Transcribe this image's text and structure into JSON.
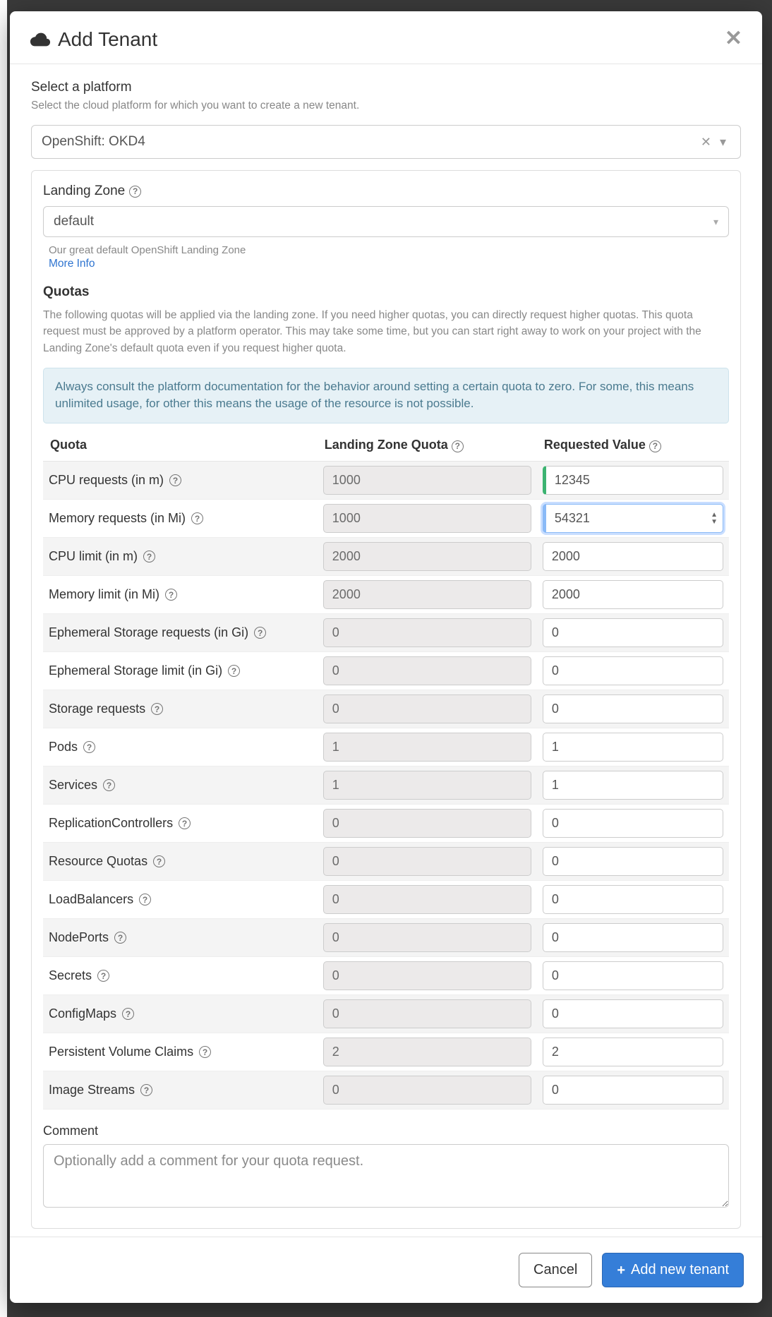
{
  "modal": {
    "title": "Add Tenant",
    "platform_section_label": "Select a platform",
    "platform_section_help": "Select the cloud platform for which you want to create a new tenant.",
    "platform_value": "OpenShift: OKD4",
    "landing_zone_label": "Landing Zone",
    "landing_zone_value": "default",
    "landing_zone_desc": "Our great default OpenShift Landing Zone",
    "landing_zone_more": "More Info",
    "quotas_title": "Quotas",
    "quotas_desc": "The following quotas will be applied via the landing zone. If you need higher quotas, you can directly request higher quotas. This quota request must be approved by a platform operator. This may take some time, but you can start right away to work on your project with the Landing Zone's default quota even if you request higher quota.",
    "quotas_info": "Always consult the platform documentation for the behavior around setting a certain quota to zero. For some, this means unlimited usage, for other this means the usage of the resource is not possible.",
    "table_headers": {
      "quota": "Quota",
      "lz": "Landing Zone Quota",
      "req": "Requested Value"
    },
    "comment_label": "Comment",
    "comment_placeholder": "Optionally add a comment for your quota request.",
    "cancel_label": "Cancel",
    "submit_label": "Add new tenant"
  },
  "quotas": [
    {
      "label": "CPU requests (in m)",
      "help": true,
      "lz": "1000",
      "req": "12345",
      "changed": true,
      "focus": false
    },
    {
      "label": "Memory requests (in Mi)",
      "help": true,
      "lz": "1000",
      "req": "54321",
      "changed": true,
      "focus": true
    },
    {
      "label": "CPU limit (in m)",
      "help": true,
      "lz": "2000",
      "req": "2000",
      "changed": false,
      "focus": false
    },
    {
      "label": "Memory limit (in Mi)",
      "help": true,
      "lz": "2000",
      "req": "2000",
      "changed": false,
      "focus": false
    },
    {
      "label": "Ephemeral Storage requests (in Gi)",
      "help": true,
      "lz": "0",
      "req": "0",
      "changed": false,
      "focus": false
    },
    {
      "label": "Ephemeral Storage limit (in Gi)",
      "help": true,
      "lz": "0",
      "req": "0",
      "changed": false,
      "focus": false
    },
    {
      "label": "Storage requests",
      "help": true,
      "lz": "0",
      "req": "0",
      "changed": false,
      "focus": false
    },
    {
      "label": "Pods",
      "help": true,
      "lz": "1",
      "req": "1",
      "changed": false,
      "focus": false
    },
    {
      "label": "Services",
      "help": true,
      "lz": "1",
      "req": "1",
      "changed": false,
      "focus": false
    },
    {
      "label": "ReplicationControllers",
      "help": true,
      "lz": "0",
      "req": "0",
      "changed": false,
      "focus": false
    },
    {
      "label": "Resource Quotas",
      "help": true,
      "lz": "0",
      "req": "0",
      "changed": false,
      "focus": false
    },
    {
      "label": "LoadBalancers",
      "help": true,
      "lz": "0",
      "req": "0",
      "changed": false,
      "focus": false
    },
    {
      "label": "NodePorts",
      "help": true,
      "lz": "0",
      "req": "0",
      "changed": false,
      "focus": false
    },
    {
      "label": "Secrets",
      "help": true,
      "lz": "0",
      "req": "0",
      "changed": false,
      "focus": false
    },
    {
      "label": "ConfigMaps",
      "help": true,
      "lz": "0",
      "req": "0",
      "changed": false,
      "focus": false
    },
    {
      "label": "Persistent Volume Claims",
      "help": true,
      "lz": "2",
      "req": "2",
      "changed": false,
      "focus": false
    },
    {
      "label": "Image Streams",
      "help": true,
      "lz": "0",
      "req": "0",
      "changed": false,
      "focus": false
    }
  ]
}
